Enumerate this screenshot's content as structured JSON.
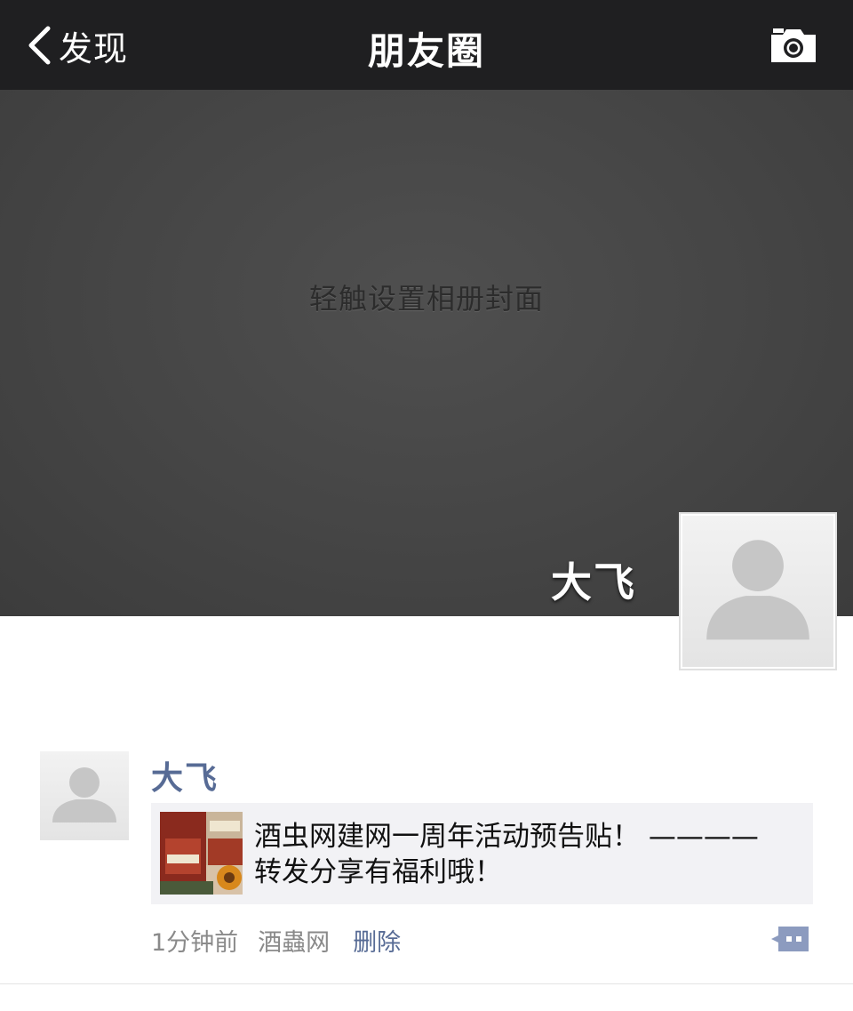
{
  "navbar": {
    "back_label": "发现",
    "title": "朋友圈",
    "back_icon": "chevron-left-icon",
    "camera_icon": "camera-icon"
  },
  "cover": {
    "hint": "轻触设置相册封面",
    "user_name": "大飞"
  },
  "post": {
    "author": "大飞",
    "share": {
      "line1": "酒虫网建网一周年活动预告贴！ ————",
      "line2": "转发分享有福利哦！"
    },
    "time": "1分钟前",
    "source": "酒蟲网",
    "delete_label": "删除",
    "comment_icon": "comment-bubble-icon"
  },
  "colors": {
    "navbar_bg": "#1f1f21",
    "cover_bg": "#464646",
    "link_blue": "#576b95",
    "card_bg": "#f2f2f5"
  }
}
